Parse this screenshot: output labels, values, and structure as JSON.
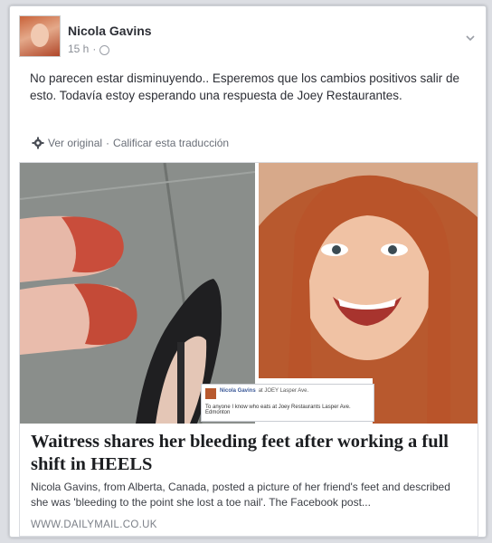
{
  "post": {
    "author": "Nicola Gavins",
    "time": "15 h",
    "separator": "·",
    "text": "No parecen estar disminuyendo.. Esperemos que los cambios positivos salir de esto. Todavía estoy esperando una respuesta de Joey Restaurantes.",
    "translation": {
      "view_original": "Ver original",
      "dot": "·",
      "rate": "Calificar esta traducción"
    }
  },
  "link": {
    "headline": "Waitress shares her bleeding feet after working a full shift in HEELS",
    "description": "Nicola Gavins, from Alberta, Canada, posted a picture of her friend's feet and described she was 'bleeding to the point she lost a toe nail'. The Facebook post...",
    "domain": "WWW.DAILYMAIL.CO.UK",
    "embedded_post": {
      "name": "Nicola Gavins",
      "tagline": "at JOEY Lasper Ave.",
      "text": "To anyone I know who eats at Joey Restaurants Lasper Ave. Edmonton"
    }
  },
  "colors": {
    "background": "#dcdee3",
    "card": "#ffffff",
    "text": "#2d2f36",
    "muted": "#8b8f97"
  },
  "icons": [
    "avatar",
    "globe-icon",
    "chevron-down-icon",
    "gear-icon"
  ]
}
